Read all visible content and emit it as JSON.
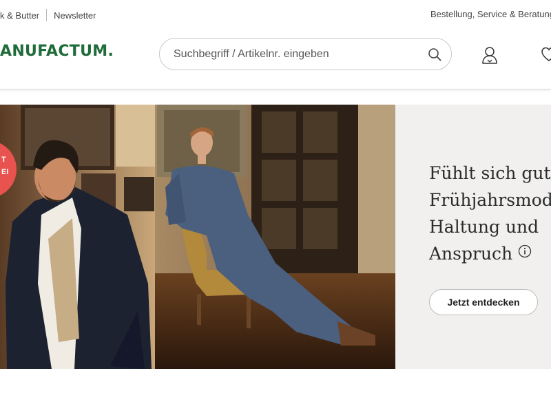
{
  "topbar": {
    "links": [
      "k & Butter",
      "Newsletter"
    ],
    "service_link": "Bestellung, Service & Beratung"
  },
  "header": {
    "logo_text": "ANUFACTUM.",
    "search_placeholder": "Suchbegriff / Artikelnr. eingeben",
    "icons": [
      "search-icon",
      "account-icon",
      "heart-icon"
    ]
  },
  "hero": {
    "headline_lines": [
      "Fühlt sich gut an",
      "Frühjahrsmode",
      "Haltung und",
      "Anspruch"
    ],
    "cta_label": "Jetzt entdecken",
    "badge_text": [
      "T",
      "EI"
    ]
  },
  "colors": {
    "brand_green": "#1f6b3a",
    "badge_red": "#e8534f",
    "panel_bg": "#f1f0ee"
  }
}
